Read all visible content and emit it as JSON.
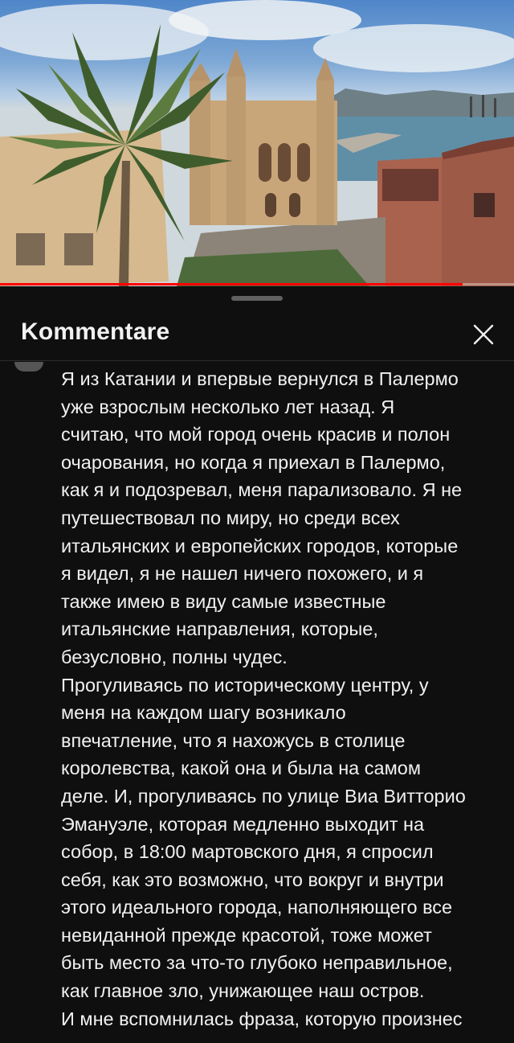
{
  "panel": {
    "title": "Kommentare",
    "close_icon": "close-icon"
  },
  "video": {
    "progress": 0.9
  },
  "comment": {
    "text": "Я из Катании и впервые вернулся в Палермо\nуже взрослым несколько лет назад. Я\nсчитаю, что мой город очень красив и полон\nочарования, но когда я приехал в Палермо,\nкак я и подозревал, меня парализовало. Я не\nпутешествовал по миру, но среди всех\nитальянских и европейских городов, которые\nя видел, я не нашел ничего похожего, и я\nтакже имею в виду самые известные\nитальянские направления, которые,\nбезусловно, полны чудес.\nПрогуливаясь по историческому центру, у\nменя на каждом шагу возникало\nвпечатление, что я нахожусь в столице\nкоролевства, какой она и была на самом\nделе. И, прогуливаясь по улице Виа Витторио\nЭмануэле, которая медленно выходит на\nсобор, в 18:00 мартовского дня, я спросил\nсебя, как это возможно, что вокруг и внутри\nэтого идеального города, наполняющего все\nневиданной прежде красотой, тоже может\nбыть место за что-то глубоко неправильное,\nкак главное зло, унижающее наш остров.\nИ мне вспомнилась фраза, которую произнес"
  }
}
